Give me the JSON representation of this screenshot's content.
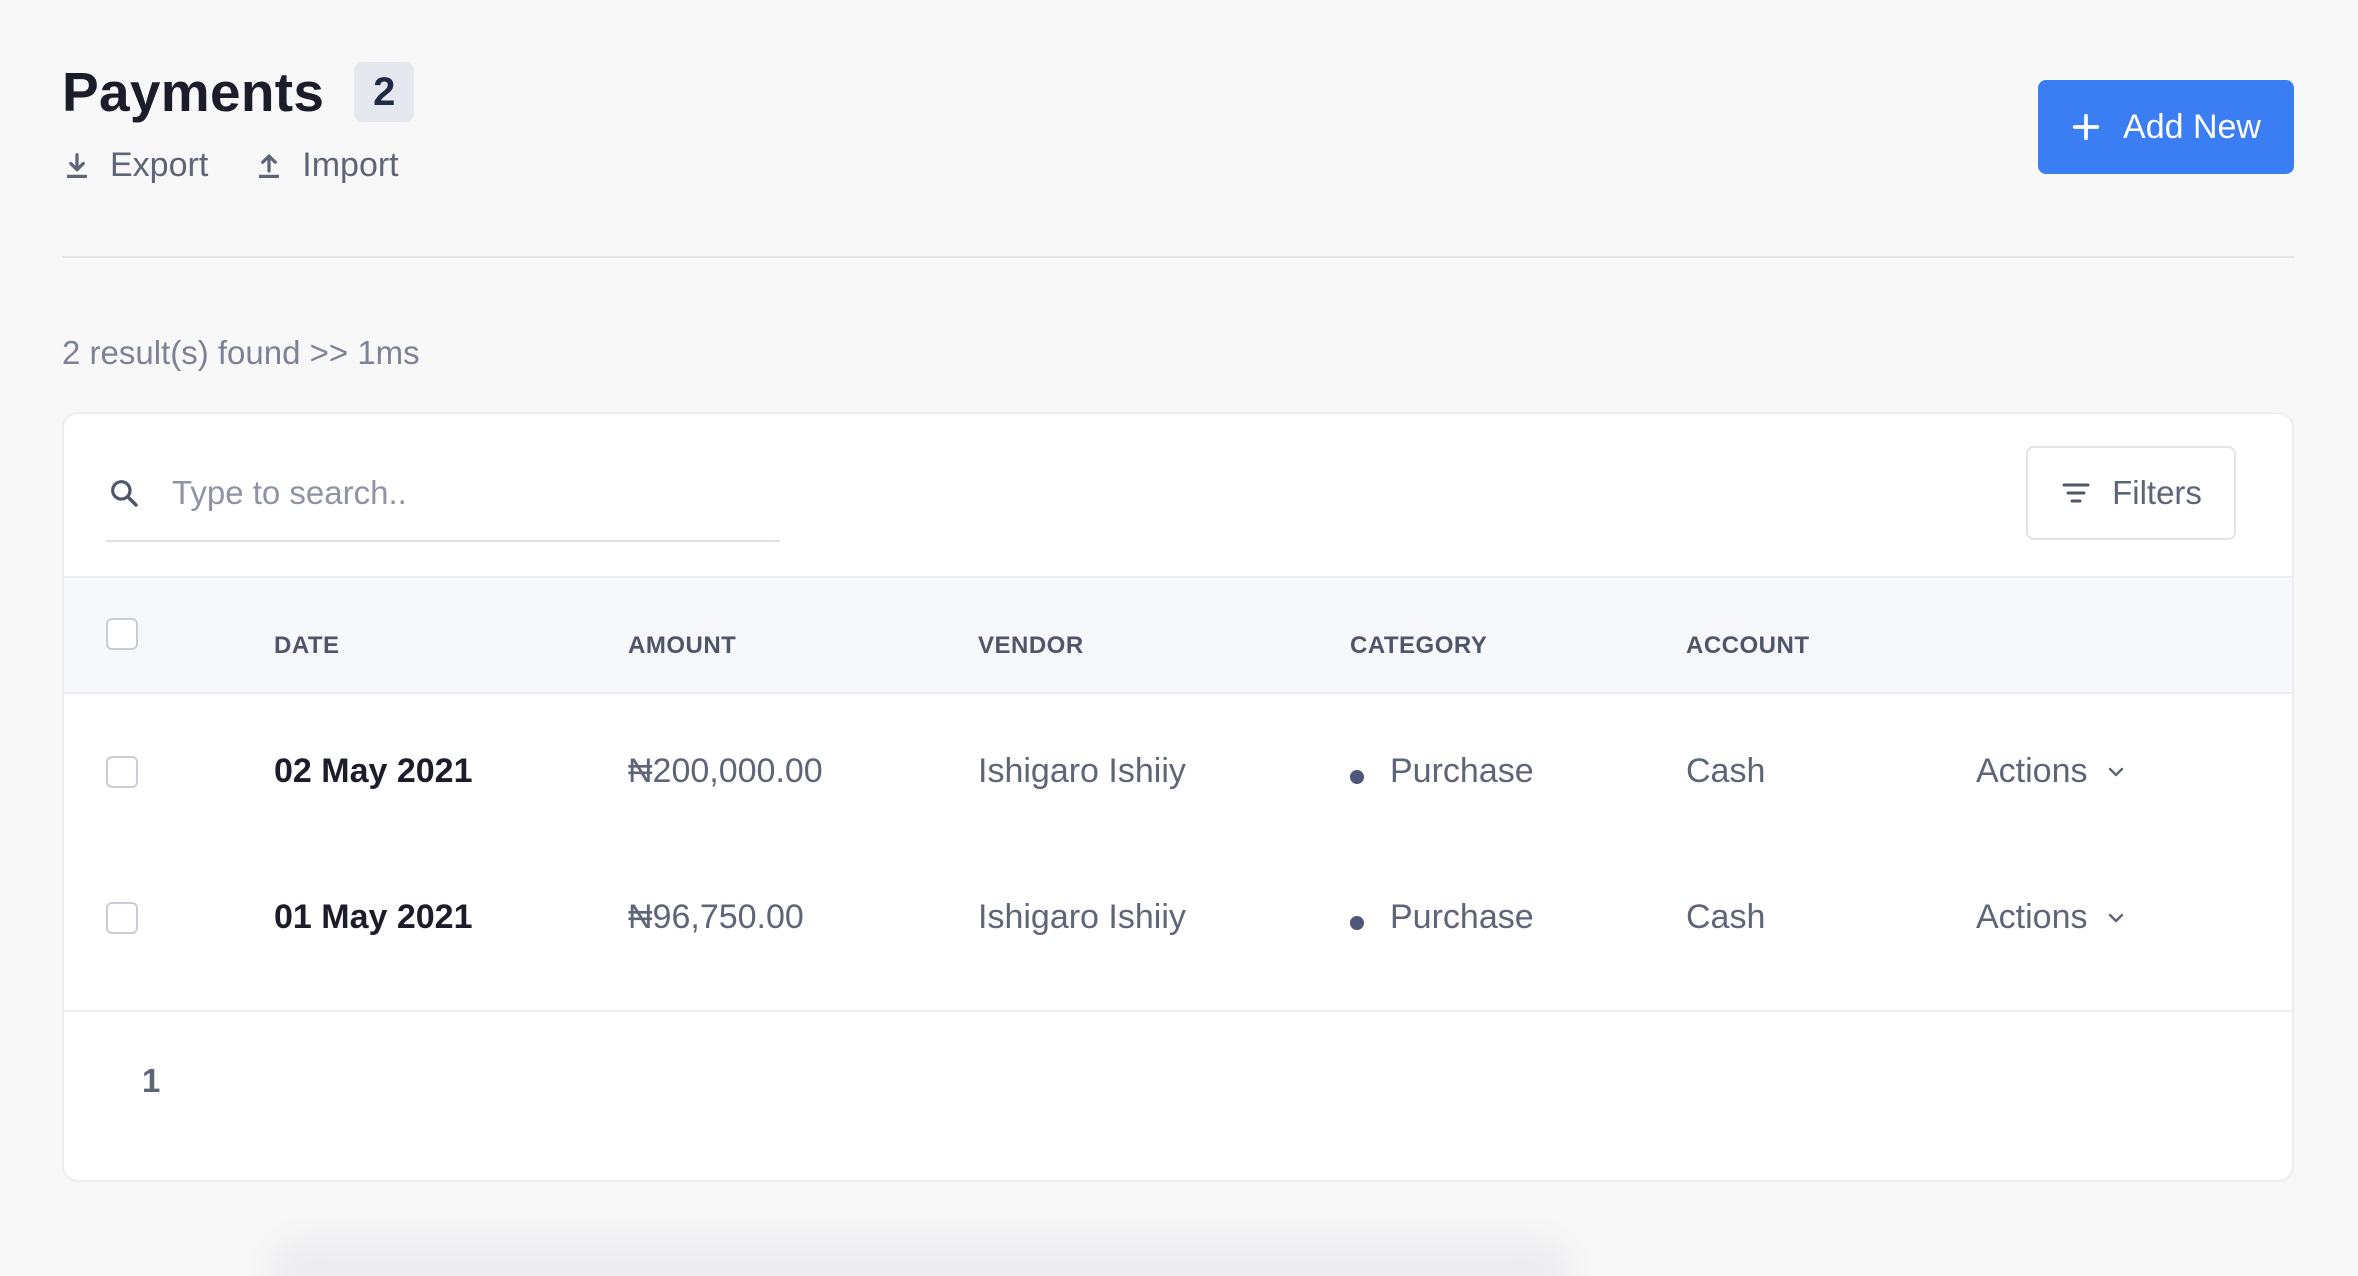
{
  "header": {
    "title": "Payments",
    "count": "2",
    "export_label": "Export",
    "import_label": "Import",
    "add_new_label": "Add New"
  },
  "results_text": "2 result(s) found >> 1ms",
  "search": {
    "placeholder": "Type to search.."
  },
  "filters_label": "Filters",
  "table": {
    "columns": [
      "DATE",
      "AMOUNT",
      "VENDOR",
      "CATEGORY",
      "ACCOUNT"
    ],
    "rows": [
      {
        "date": "02 May 2021",
        "amount": "₦200,000.00",
        "vendor": "Ishigaro Ishiiy",
        "category": "Purchase",
        "account": "Cash",
        "actions": "Actions"
      },
      {
        "date": "01 May 2021",
        "amount": "₦96,750.00",
        "vendor": "Ishigaro Ishiiy",
        "category": "Purchase",
        "account": "Cash",
        "actions": "Actions"
      }
    ]
  },
  "pagination": {
    "current_page": "1"
  },
  "colors": {
    "accent": "#3b7df2",
    "badge_bg": "#e6e8ef",
    "category_dot": "#4f5677",
    "table_header_bg": "#f7f8fb"
  },
  "icons": {
    "export": "download-icon",
    "import": "upload-icon",
    "add": "plus-icon",
    "search": "search-icon",
    "filters": "filter-icon",
    "actions": "chevron-down-icon"
  }
}
